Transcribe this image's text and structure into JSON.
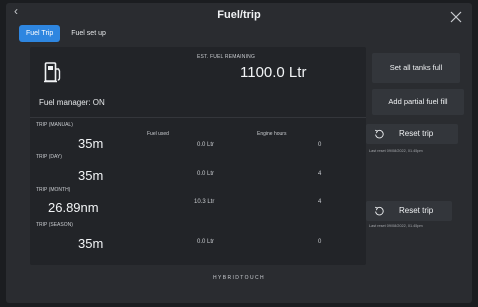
{
  "header": {
    "back_icon": "chevron-left-icon",
    "title": "Fuel/trip",
    "close_icon": "close-icon"
  },
  "tabs": [
    {
      "label": "Fuel Trip",
      "active": true
    },
    {
      "label": "Fuel set up",
      "active": false
    }
  ],
  "fuel": {
    "pump_icon": "fuel-pump-icon",
    "est_label": "EST. FUEL REMAINING",
    "est_value": "1100.0 Ltr",
    "manager_status": "Fuel manager: ON"
  },
  "columns": {
    "fuel_used": "Fuel used",
    "engine_hours": "Engine hours"
  },
  "trips": [
    {
      "label": "TRIP (MANUAL)",
      "distance": "35m",
      "fuel_used": "0.0 Ltr",
      "engine_hours": "0"
    },
    {
      "label": "TRIP (DAY)",
      "distance": "35m",
      "fuel_used": "0.0 Ltr",
      "engine_hours": "4"
    },
    {
      "label": "TRIP (MONTH)",
      "distance": "26.89nm",
      "fuel_used": "10.3 Ltr",
      "engine_hours": "4"
    },
    {
      "label": "TRIP (SEASON)",
      "distance": "35m",
      "fuel_used": "0.0 Ltr",
      "engine_hours": "0"
    }
  ],
  "actions": {
    "set_all_tanks": "Set all tanks full",
    "add_partial": "Add partial fuel fill",
    "reset_1": {
      "label": "Reset trip",
      "last_reset": "Last reset 09/08/2022, 01.45pm",
      "icon": "reset-icon"
    },
    "reset_2": {
      "label": "Reset trip",
      "last_reset": "Last reset 09/08/2022, 01.45pm",
      "icon": "reset-icon"
    }
  },
  "footer": {
    "brand": "HYBRIDTOUCH"
  },
  "colors": {
    "accent": "#2e86e0",
    "background": "#2a2c30",
    "panel": "#222428",
    "button": "#33363b"
  }
}
